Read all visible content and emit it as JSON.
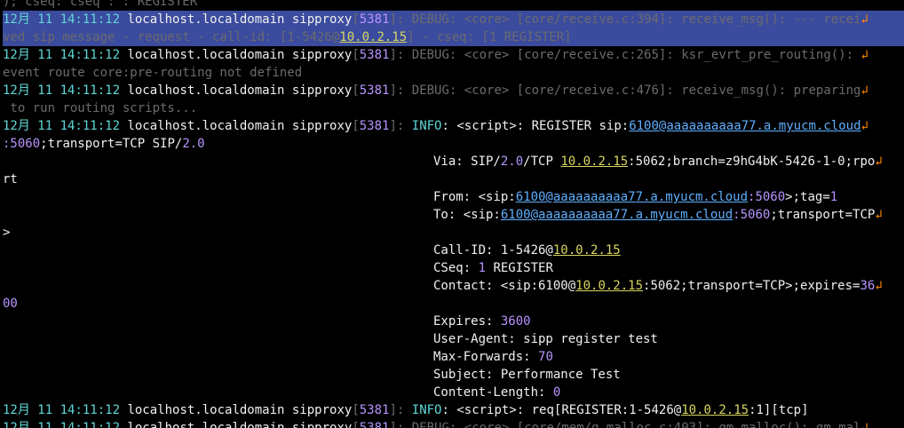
{
  "colors": {
    "background": "#000000",
    "text": "#f0f0f0",
    "date": "#5fd7d7",
    "number": "#b694ff",
    "ip": "#d7d75f",
    "url": "#5fafff",
    "debug": "#6b6b6b",
    "info": "#5fd7d7",
    "highlight": "#3b4b9e",
    "wrap_glyph": "#ff8700"
  },
  "lines": [
    [
      {
        "t": "); cseq: cseq : : REGISTER",
        "c": "dim"
      }
    ],
    [
      {
        "t": "12月 11 14:11:12 localhost.localdomain sipproxy",
        "c": "hdr"
      },
      {
        "t": "[",
        "c": "dim"
      },
      {
        "t": "5381",
        "c": "num"
      },
      {
        "t": "]: ",
        "c": "dim"
      },
      {
        "t": "DEBUG: <core> [core/receive.c:394]: receive_msg(): --- recei",
        "c": "dbg"
      },
      {
        "t": "↲",
        "c": "wrapg"
      }
    ],
    [
      {
        "t": "ved sip message - request - call-id: [1-5426@",
        "c": "dbg"
      },
      {
        "t": "10.0.2.15",
        "c": "ipu"
      },
      {
        "t": "] - cseq: [1 REGISTER]",
        "c": "dbg"
      }
    ],
    [
      {
        "t": "12月 11 14:11:12 localhost.localdomain sipproxy",
        "c": "hdr"
      },
      {
        "t": "[",
        "c": "dim"
      },
      {
        "t": "5381",
        "c": "num"
      },
      {
        "t": "]: ",
        "c": "dim"
      },
      {
        "t": "DEBUG: <core> [core/receive.c:265]: ksr_evrt_pre_routing(): ",
        "c": "dbg"
      },
      {
        "t": "↲",
        "c": "wrapg"
      }
    ],
    [
      {
        "t": "event route core:pre-routing not defined",
        "c": "dbg"
      }
    ],
    [
      {
        "t": "12月 11 14:11:12 localhost.localdomain sipproxy",
        "c": "hdr"
      },
      {
        "t": "[",
        "c": "dim"
      },
      {
        "t": "5381",
        "c": "num"
      },
      {
        "t": "]: ",
        "c": "dim"
      },
      {
        "t": "DEBUG: <core> [core/receive.c:476]: receive_msg(): preparing",
        "c": "dbg"
      },
      {
        "t": "↲",
        "c": "wrapg"
      }
    ],
    [
      {
        "t": " to run routing scripts...",
        "c": "dbg"
      }
    ],
    [
      {
        "t": "12月 11 14:11:12 localhost.localdomain sipproxy",
        "c": "hdr"
      },
      {
        "t": "[",
        "c": "dim"
      },
      {
        "t": "5381",
        "c": "num"
      },
      {
        "t": "]: ",
        "c": "dim"
      },
      {
        "t": "INFO",
        "c": "info"
      },
      {
        "t": ": <script>: REGISTER sip:",
        "c": "txt"
      },
      {
        "t": "6100@aaaaaaaaaa77.a.myucm.cloud",
        "c": "url"
      },
      {
        "t": "↲",
        "c": "wrapg"
      }
    ],
    [
      {
        "t": ":5060",
        "c": "num"
      },
      {
        "t": ";transport=TCP SIP/",
        "c": "txt"
      },
      {
        "t": "2.0",
        "c": "num"
      }
    ],
    [
      {
        "t": "",
        "c": "gap"
      },
      {
        "t": "Via: SIP/",
        "c": "txt"
      },
      {
        "t": "2.0",
        "c": "num"
      },
      {
        "t": "/TCP ",
        "c": "txt"
      },
      {
        "t": "10.0.2.15",
        "c": "ipu"
      },
      {
        "t": ":5062;branch=z9hG4bK-5426-1-0;rpo",
        "c": "txt"
      },
      {
        "t": "↲",
        "c": "wrapg"
      }
    ],
    [
      {
        "t": "rt",
        "c": "txt"
      }
    ],
    [
      {
        "t": "",
        "c": "gap"
      },
      {
        "t": "From: <sip:",
        "c": "txt"
      },
      {
        "t": "6100@aaaaaaaaaa77.a.myucm.cloud",
        "c": "url"
      },
      {
        "t": ":5060",
        "c": "num"
      },
      {
        "t": ">;tag=",
        "c": "txt"
      },
      {
        "t": "1",
        "c": "num"
      }
    ],
    [
      {
        "t": "",
        "c": "gap"
      },
      {
        "t": "To: <sip:",
        "c": "txt"
      },
      {
        "t": "6100@aaaaaaaaaa77.a.myucm.cloud",
        "c": "url"
      },
      {
        "t": ":5060",
        "c": "num"
      },
      {
        "t": ";transport=TCP",
        "c": "txt"
      },
      {
        "t": "↲",
        "c": "wrapg"
      }
    ],
    [
      {
        "t": ">",
        "c": "txt"
      }
    ],
    [
      {
        "t": "",
        "c": "gap"
      },
      {
        "t": "Call-ID: 1-5426@",
        "c": "txt"
      },
      {
        "t": "10.0.2.15",
        "c": "ipu"
      }
    ],
    [
      {
        "t": "",
        "c": "gap"
      },
      {
        "t": "CSeq: ",
        "c": "txt"
      },
      {
        "t": "1",
        "c": "num"
      },
      {
        "t": " REGISTER",
        "c": "txt"
      }
    ],
    [
      {
        "t": "",
        "c": "gap"
      },
      {
        "t": "Contact: <sip:6100@",
        "c": "txt"
      },
      {
        "t": "10.0.2.15",
        "c": "ipu"
      },
      {
        "t": ":5062;transport=TCP>;expires=",
        "c": "txt"
      },
      {
        "t": "36",
        "c": "num"
      },
      {
        "t": "↲",
        "c": "wrapg"
      }
    ],
    [
      {
        "t": "00",
        "c": "num"
      }
    ],
    [
      {
        "t": "",
        "c": "gap"
      },
      {
        "t": "Expires: ",
        "c": "txt"
      },
      {
        "t": "3600",
        "c": "num"
      }
    ],
    [
      {
        "t": "",
        "c": "gap"
      },
      {
        "t": "User-Agent: sipp register test",
        "c": "txt"
      }
    ],
    [
      {
        "t": "",
        "c": "gap"
      },
      {
        "t": "Max-Forwards: ",
        "c": "txt"
      },
      {
        "t": "70",
        "c": "num"
      }
    ],
    [
      {
        "t": "",
        "c": "gap"
      },
      {
        "t": "Subject: Performance Test",
        "c": "txt"
      }
    ],
    [
      {
        "t": "",
        "c": "gap"
      },
      {
        "t": "Content-Length: ",
        "c": "txt"
      },
      {
        "t": "0",
        "c": "num"
      }
    ],
    [
      {
        "t": "12月 11 14:11:12 localhost.localdomain sipproxy",
        "c": "hdr"
      },
      {
        "t": "[",
        "c": "dim"
      },
      {
        "t": "5381",
        "c": "num"
      },
      {
        "t": "]: ",
        "c": "dim"
      },
      {
        "t": "INFO",
        "c": "info"
      },
      {
        "t": ": <script>: req[REGISTER:1-5426@",
        "c": "txt"
      },
      {
        "t": "10.0.2.15",
        "c": "ipu"
      },
      {
        "t": ":1][tcp]",
        "c": "txt"
      }
    ],
    [
      {
        "t": "12月 11 14:11:12 localhost.localdomain sipproxy",
        "c": "hdr"
      },
      {
        "t": "[",
        "c": "dim"
      },
      {
        "t": "5381",
        "c": "num"
      },
      {
        "t": "]: ",
        "c": "dim"
      },
      {
        "t": "DEBUG: <core> [core/mem/q_malloc.c:403]: qm_malloc(): qm_mal",
        "c": "dbg"
      },
      {
        "t": "↲",
        "c": "wrapg"
      }
    ]
  ]
}
